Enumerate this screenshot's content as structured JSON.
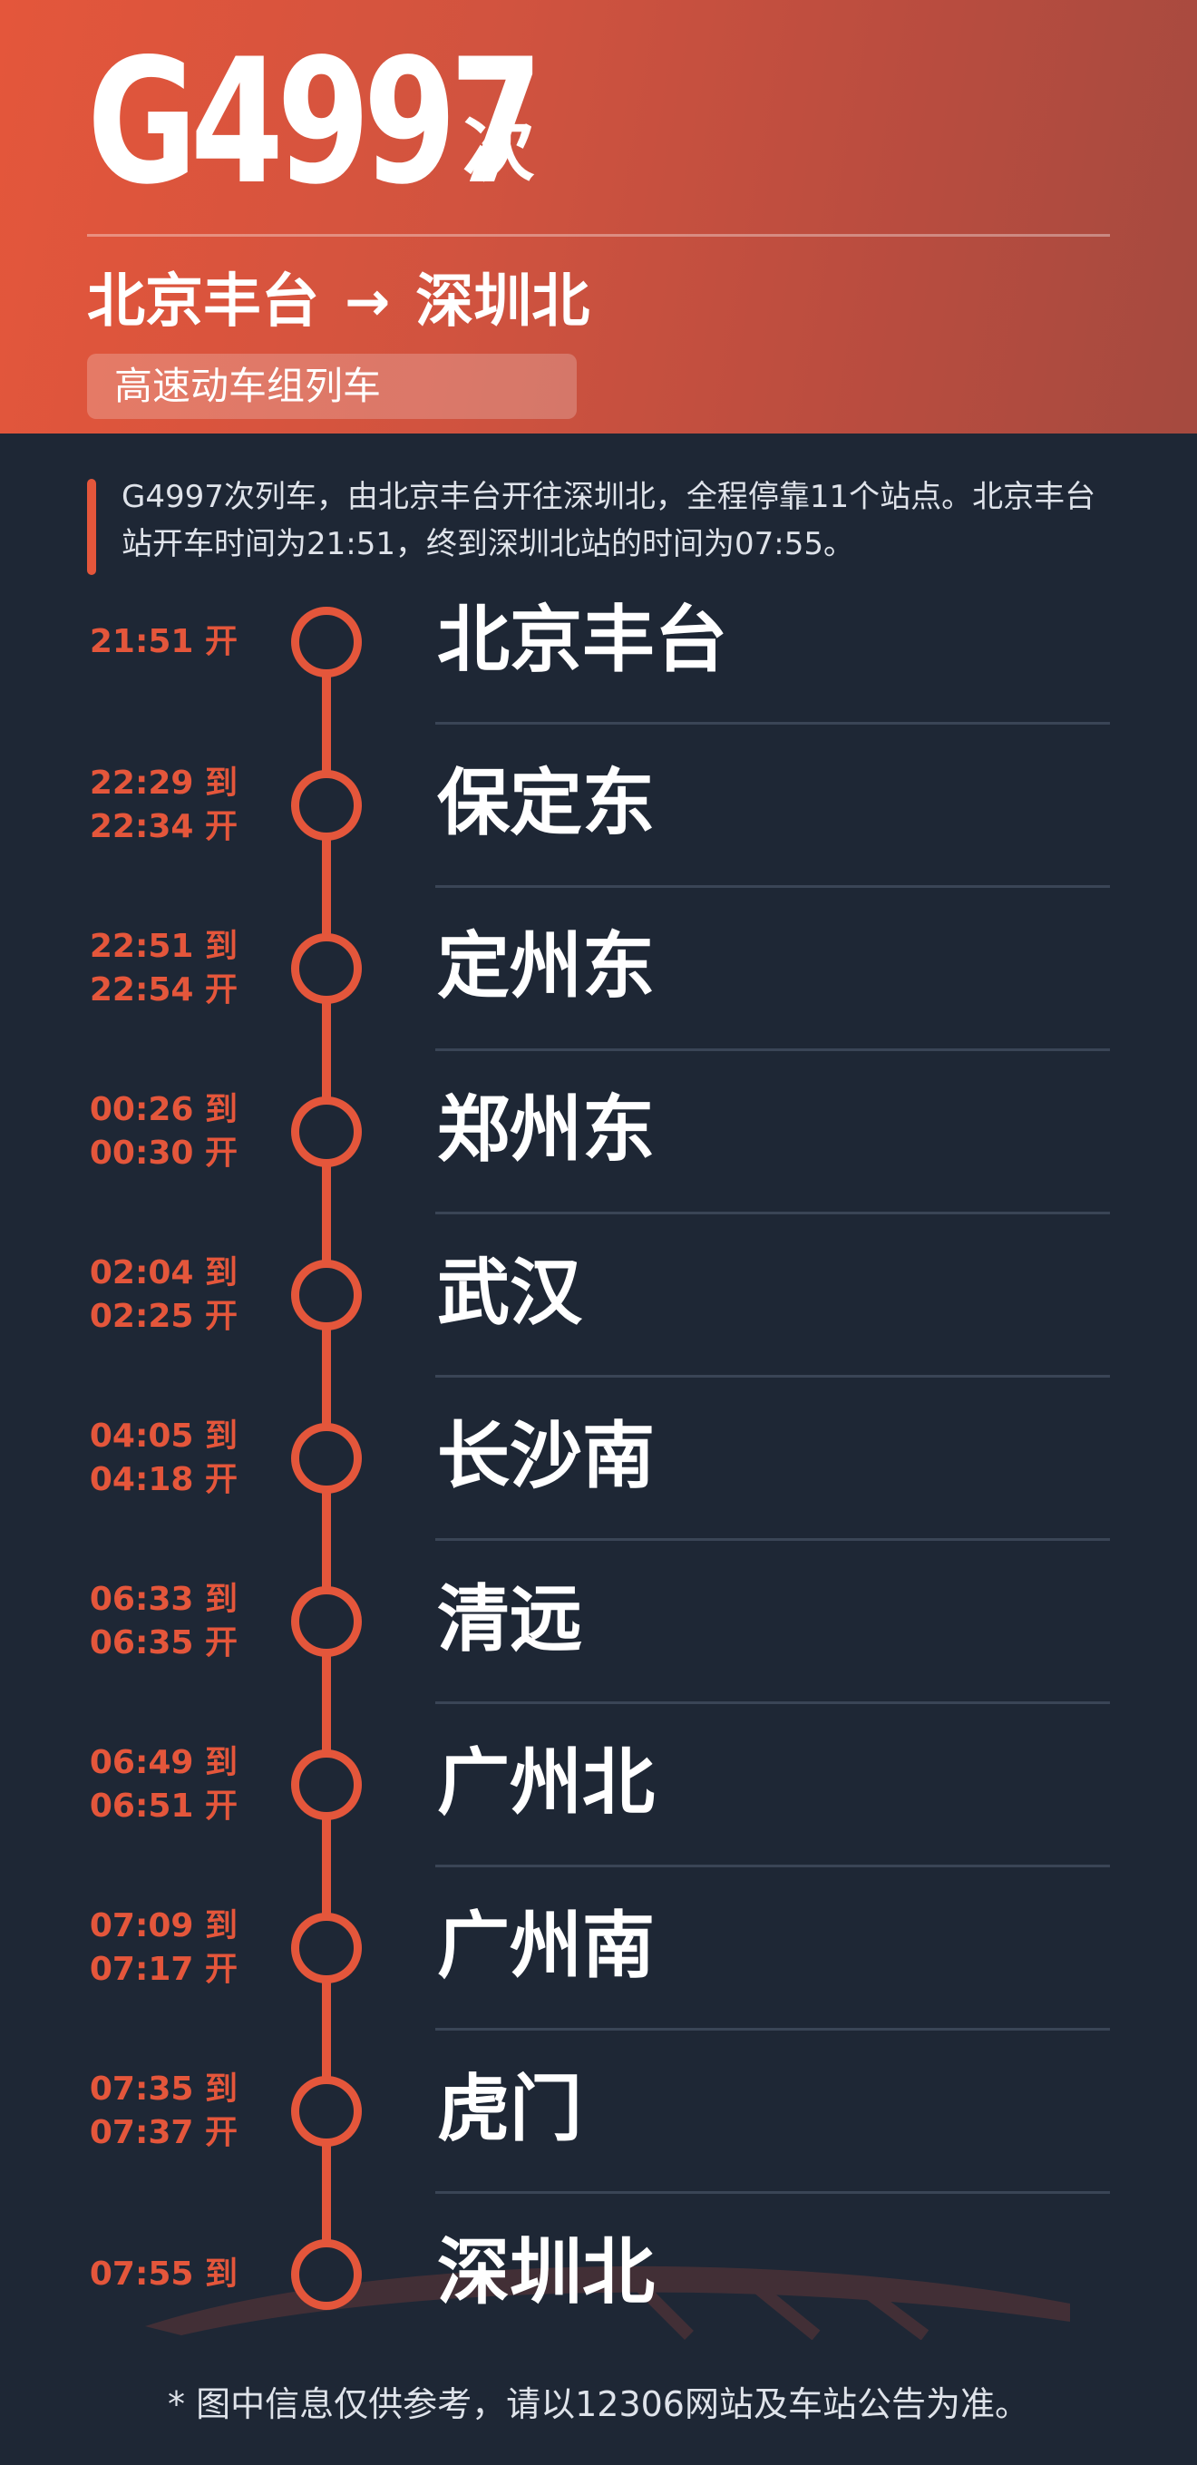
{
  "header": {
    "train_number": "G4997",
    "train_suffix": "次",
    "origin": "北京丰台",
    "arrow": "→",
    "destination": "深圳北",
    "train_type": "高速动车组列车"
  },
  "summary": "G4997次列车，由北京丰台开往深圳北，全程停靠11个站点。北京丰台站开车时间为21:51，终到深圳北站的时间为07:55。",
  "stops": [
    {
      "name": "北京丰台",
      "times": [
        "21:51 开"
      ]
    },
    {
      "name": "保定东",
      "times": [
        "22:29 到",
        "22:34 开"
      ]
    },
    {
      "name": "定州东",
      "times": [
        "22:51 到",
        "22:54 开"
      ]
    },
    {
      "name": "郑州东",
      "times": [
        "00:26 到",
        "00:30 开"
      ]
    },
    {
      "name": "武汉",
      "times": [
        "02:04 到",
        "02:25 开"
      ]
    },
    {
      "name": "长沙南",
      "times": [
        "04:05 到",
        "04:18 开"
      ]
    },
    {
      "name": "清远",
      "times": [
        "06:33 到",
        "06:35 开"
      ]
    },
    {
      "name": "广州北",
      "times": [
        "06:49 到",
        "06:51 开"
      ]
    },
    {
      "name": "广州南",
      "times": [
        "07:09 到",
        "07:17 开"
      ]
    },
    {
      "name": "虎门",
      "times": [
        "07:35 到",
        "07:37 开"
      ]
    },
    {
      "name": "深圳北",
      "times": [
        "07:55 到"
      ]
    }
  ],
  "footer": "* 图中信息仅供参考，请以12306网站及车站公告为准。",
  "colors": {
    "accent": "#e4563b",
    "background": "#1e2735",
    "divider": "#3a4556"
  }
}
